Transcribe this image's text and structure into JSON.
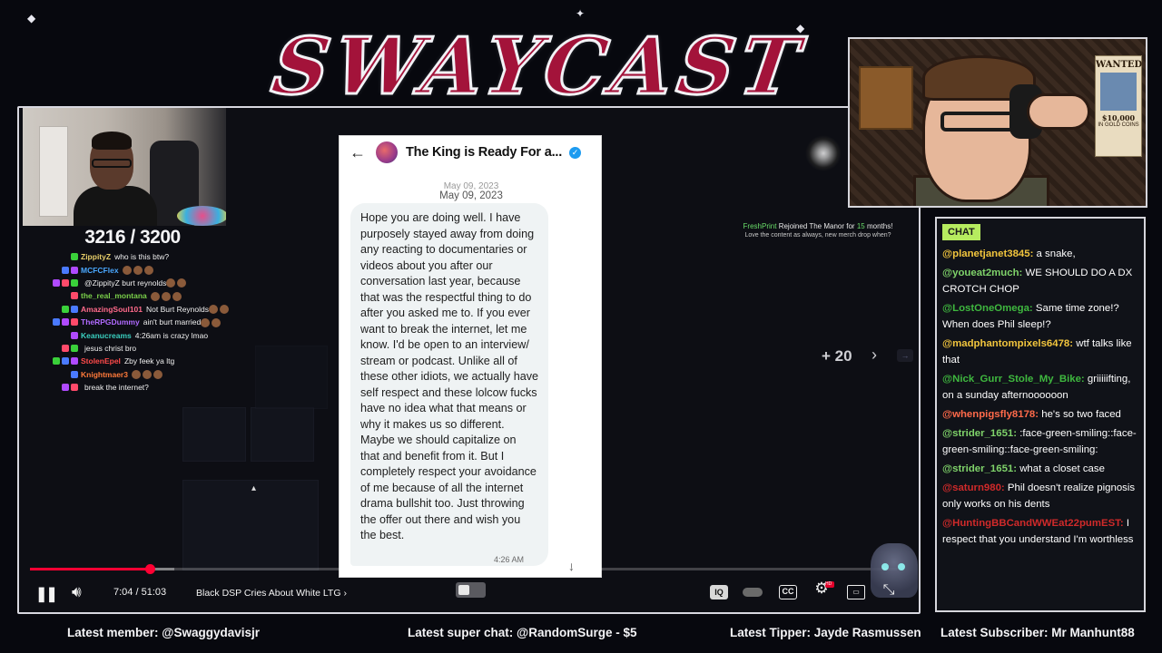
{
  "logo": {
    "text": "SWAYCAST"
  },
  "stream": {
    "counter": "3216 / 3200",
    "mini_chat": [
      {
        "user": "ZippityZ",
        "color": "#e8cf6a",
        "msg": "who is this btw?"
      },
      {
        "user": "MCFCFlex",
        "color": "#4aa8ff",
        "msg": ""
      },
      {
        "user": "",
        "color": "#3a4bff",
        "msg": "@ZippityZ burt reynolds"
      },
      {
        "user": "the_real_montana",
        "color": "#7ad04a",
        "msg": ""
      },
      {
        "user": "AmazingSoul101",
        "color": "#ff6a8a",
        "msg": "Not Burt Reynolds"
      },
      {
        "user": "TheRPGDummy",
        "color": "#b06aff",
        "msg": "ain't burt married"
      },
      {
        "user": "Keanucreams",
        "color": "#3ad0c0",
        "msg": "4:26am is crazy lmao"
      },
      {
        "user": "",
        "color": "#3a4bff",
        "msg": "jesus christ bro"
      },
      {
        "user": "StolenEpel",
        "color": "#ff4a4a",
        "msg": "Zby feek ya ltg"
      },
      {
        "user": "Knightmaer3",
        "color": "#ff7a3a",
        "msg": ""
      },
      {
        "user": "",
        "color": "#3a4bff",
        "msg": "break the internet?"
      }
    ]
  },
  "dm": {
    "name": "The King is Ready For a...",
    "date_faded": "May 09, 2023",
    "date": "May 09, 2023",
    "message": "Hope you are doing well. I have purposely stayed away from doing any reacting to documentaries or videos about you after our conversation last year, because that was the respectful thing to do after you asked me to. If you ever want to break the internet, let me know. I'd be open to an interview/ stream or podcast. Unlike all of these other idiots, we actually have self respect and these lolcow fucks have no idea what that means or why it makes us so different. Maybe we should capitalize on that and benefit from it. But I completely respect your avoidance of me because of all the internet drama bullshit too. Just throwing the offer out there and wish you the best.",
    "time": "4:26 AM"
  },
  "sub_alert": {
    "user": "FreshPrint",
    "text_a": "Rejoined The Manor for",
    "months": "15",
    "text_b": "months!",
    "message": "Love the content as always, new merch drop when?"
  },
  "gallery": {
    "more": "+ 20"
  },
  "player": {
    "current_time": "7:04",
    "duration": "51:03",
    "time_display": "7:04 / 51:03",
    "title": "Black DSP Cries About White LTG",
    "progress": 0.138,
    "buffered": 0.166,
    "accent": "#ff0033"
  },
  "wanted": {
    "title": "WANTED",
    "reward": "$10,000",
    "sub": "IN GOLD COINS"
  },
  "chat": {
    "header": "CHAT",
    "messages": [
      {
        "user": "@planetjanet3845:",
        "color": "#f2c53d",
        "msg": "a snake,"
      },
      {
        "user": "@youeat2much:",
        "color": "#7fd36a",
        "msg": "WE SHOULD DO A DX CROTCH CHOP"
      },
      {
        "user": "@LostOneOmega:",
        "color": "#3fb83f",
        "msg": "Same time zone!? When does Phil sleep!?"
      },
      {
        "user": "@madphantompixels6478:",
        "color": "#f2c53d",
        "msg": "wtf talks like that"
      },
      {
        "user": "@Nick_Gurr_Stole_My_Bike:",
        "color": "#3fb83f",
        "msg": "griiiiifting, on a sunday afternoooooon"
      },
      {
        "user": "@whenpigsfly8178:",
        "color": "#ff6a4a",
        "msg": "he's so two faced"
      },
      {
        "user": "@strider_1651:",
        "color": "#7fd36a",
        "msg": ":face-green-smiling::face-green-smiling::face-green-smiling:"
      },
      {
        "user": "@strider_1651:",
        "color": "#7fd36a",
        "msg": "what a closet case"
      },
      {
        "user": "@saturn980:",
        "color": "#d02a2a",
        "msg": "Phil doesn't realize pignosis only works on his dents"
      },
      {
        "user": "@HuntingBBCandWWEat22pumEST:",
        "color": "#d02a2a",
        "msg": "I respect that you understand I'm worthless"
      }
    ]
  },
  "ticker": {
    "member": "Latest member: @Swaggydavisjr",
    "superchat": "Latest super chat: @RandomSurge - $5",
    "tipper": "Latest Tipper: Jayde Rasmussen",
    "subscriber": "Latest Subscriber: Mr Manhunt88"
  }
}
